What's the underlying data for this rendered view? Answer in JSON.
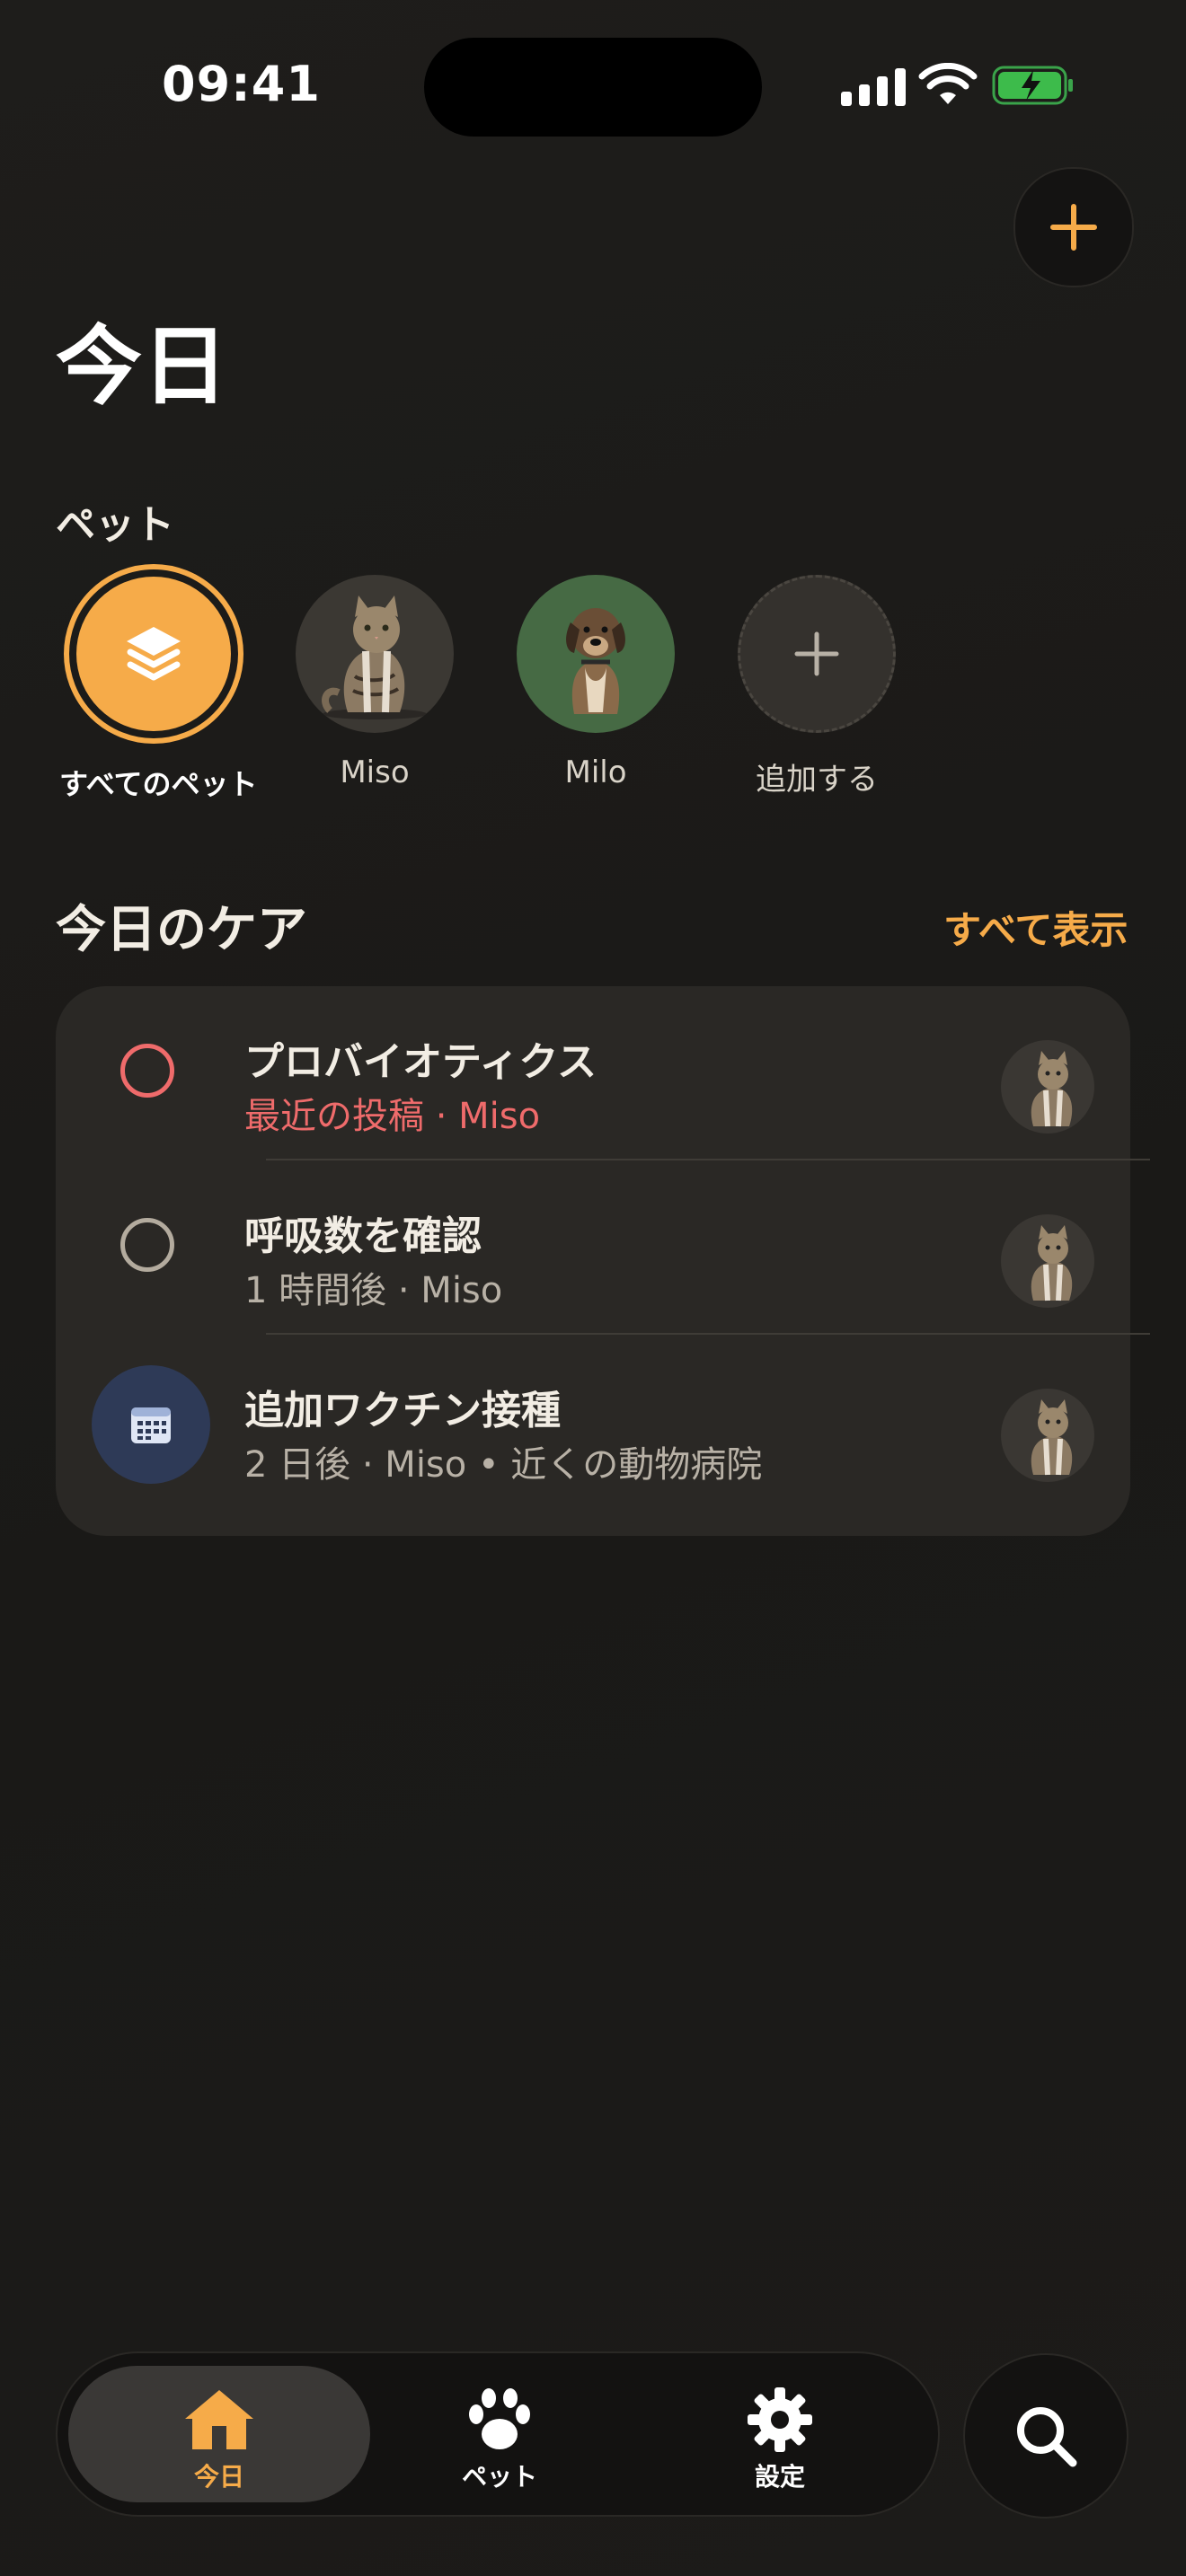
{
  "status": {
    "time": "09:41"
  },
  "header": {
    "title": "今日",
    "pets_section": "ペット"
  },
  "pets": [
    {
      "label": "すべてのペット",
      "icon": "layers-icon",
      "selected": true
    },
    {
      "label": "Miso",
      "icon": "cat-photo"
    },
    {
      "label": "Milo",
      "icon": "dog-photo"
    },
    {
      "label": "追加する",
      "icon": "plus-icon"
    }
  ],
  "care": {
    "title": "今日のケア",
    "show_all": "すべて表示",
    "items": [
      {
        "name": "プロバイオティクス",
        "sub": "最近の投稿 · Miso",
        "status": "overdue"
      },
      {
        "name": "呼吸数を確認",
        "sub": "1 時間後 · Miso",
        "status": "pending"
      },
      {
        "name": "追加ワクチン接種",
        "sub": "2 日後 · Miso • 近くの動物病院",
        "status": "appointment"
      }
    ]
  },
  "tabs": [
    {
      "label": "今日",
      "icon": "home-icon",
      "active": true
    },
    {
      "label": "ペット",
      "icon": "paw-icon"
    },
    {
      "label": "設定",
      "icon": "gear-icon"
    }
  ],
  "colors": {
    "accent": "#f6ab49",
    "alert": "#ef6b6b",
    "card": "#2a2825"
  }
}
